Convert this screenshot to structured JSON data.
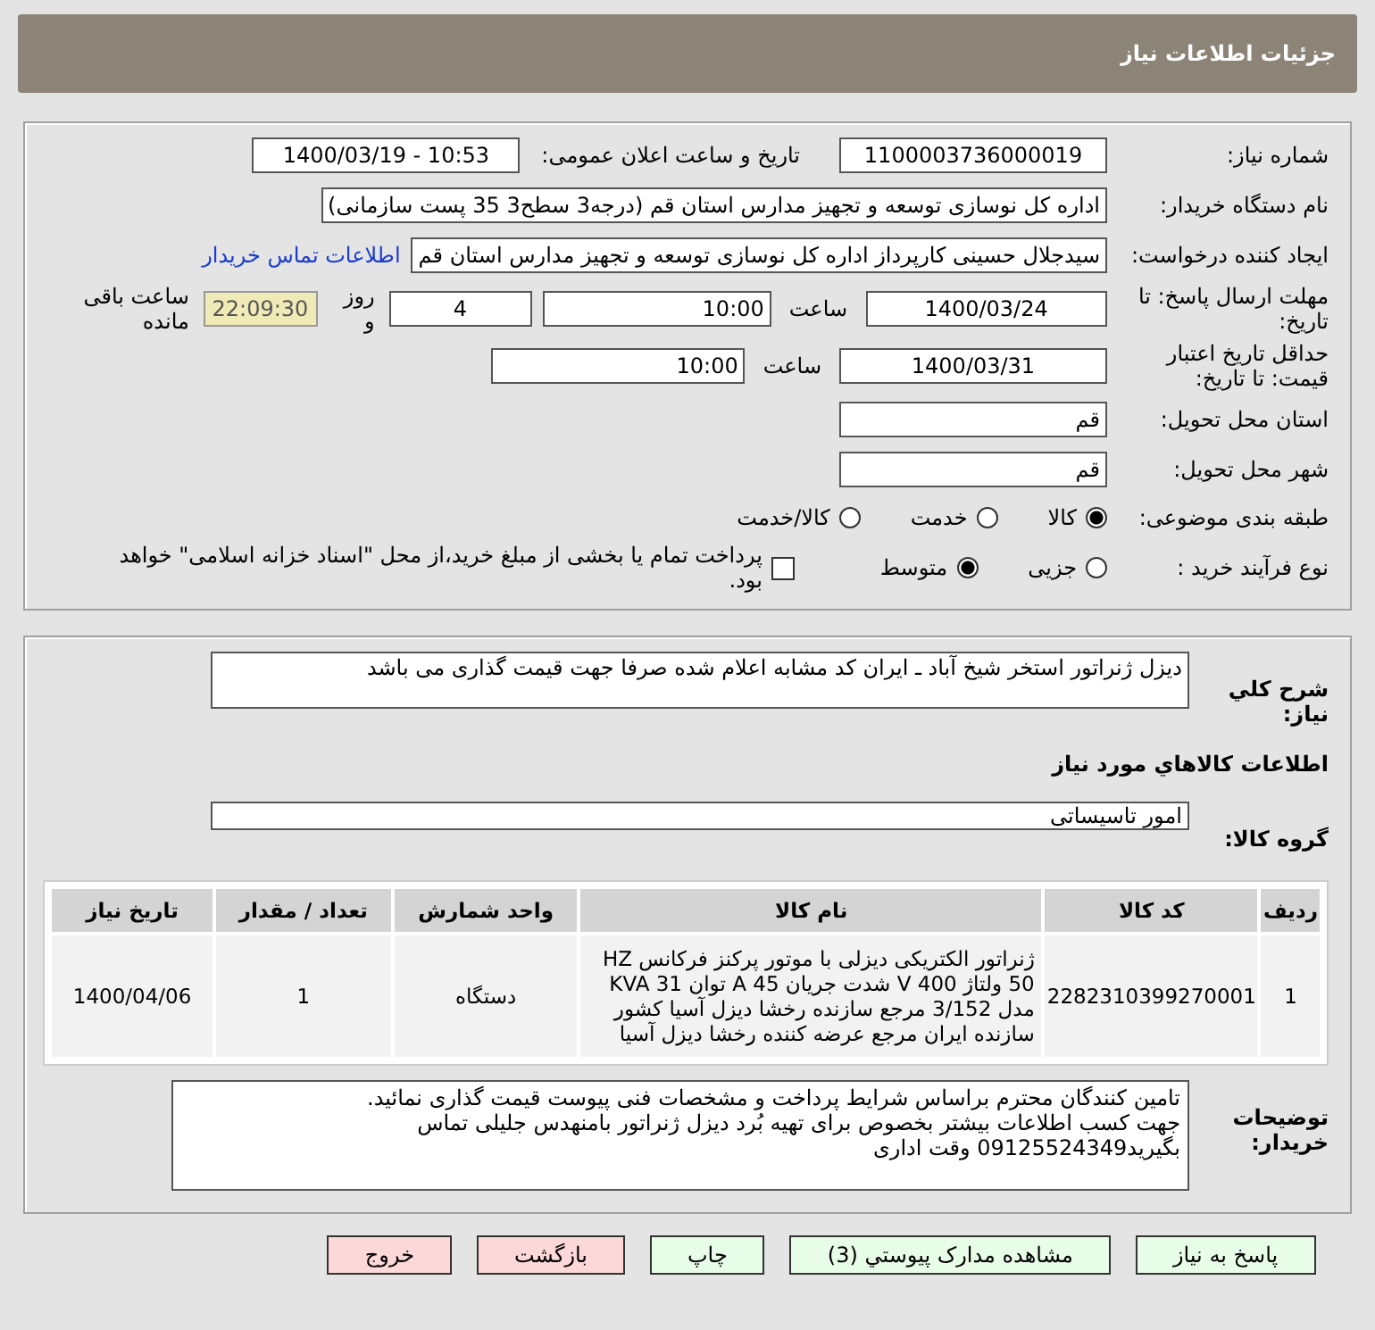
{
  "header": {
    "title": "جزئیات اطلاعات نیاز"
  },
  "details": {
    "need_number": {
      "label": "شماره نیاز:",
      "value": "1100003736000019"
    },
    "announce": {
      "label": "تاریخ و ساعت اعلان عمومی:",
      "value": "1400/03/19 - 10:53"
    },
    "buyer": {
      "label": "نام دستگاه خریدار:",
      "value": "اداره کل نوسازی   توسعه و تجهیز مدارس استان قم (درجه3 سطح3  35 پست سازمانی)"
    },
    "creator": {
      "label": "ایجاد کننده درخواست:",
      "value": "سیدجلال حسینی کارپرداز اداره کل نوسازی   توسعه و تجهیز مدارس استان قم",
      "link": "اطلاعات تماس خریدار"
    },
    "deadline": {
      "label": "مهلت ارسال پاسخ: تا تاریخ:",
      "date": "1400/03/24",
      "time_label": "ساعت",
      "time": "10:00",
      "days": "4",
      "days_label": "روز و",
      "remaining": "22:09:30",
      "remaining_label": "ساعت باقی مانده"
    },
    "validity": {
      "label": "حداقل تاریخ اعتبار قیمت: تا تاریخ:",
      "date": "1400/03/31",
      "time_label": "ساعت",
      "time": "10:00"
    },
    "province": {
      "label": "استان محل تحویل:",
      "value": "قم"
    },
    "city": {
      "label": "شهر محل تحویل:",
      "value": "قم"
    },
    "category": {
      "label": "طبقه بندی موضوعی:",
      "options": [
        {
          "label": "کالا",
          "selected": true
        },
        {
          "label": "خدمت",
          "selected": false
        },
        {
          "label": "کالا/خدمت",
          "selected": false
        }
      ]
    },
    "process": {
      "label": "نوع فرآیند خرید :",
      "options": [
        {
          "label": "جزیی",
          "selected": false
        },
        {
          "label": "متوسط",
          "selected": true
        }
      ],
      "payment": {
        "checked": false,
        "label": "پرداخت تمام یا بخشی از مبلغ خرید،از محل \"اسناد خزانه اسلامی\" خواهد بود."
      }
    }
  },
  "needs": {
    "description": {
      "label": "شرح کلي نياز:",
      "value": "دیزل ژنراتور استخر شیخ آباد ـ ایران کد مشابه اعلام شده صرفا جهت قیمت گذاری می باشد"
    },
    "section_title": "اطلاعات کالاهاي مورد نياز",
    "group": {
      "label": "گروه کالا:",
      "value": "امور تاسیساتی"
    },
    "table": {
      "columns": [
        "ردیف",
        "کد کالا",
        "نام کالا",
        "واحد شمارش",
        "تعداد / مقدار",
        "تاریخ نیاز"
      ],
      "rows": [
        [
          "1",
          "2282310399270001",
          "ژنراتور الکتریکی دیزلی با موتور پرکنز فرکانس HZ 50 ولتاژ 400 V شدت جریان A 45 توان KVA 31 مدل 3/152 مرجع سازنده رخشا دیزل آسیا کشور سازنده ایران مرجع عرضه کننده رخشا دیزل آسیا",
          "دستگاه",
          "1",
          "1400/04/06"
        ]
      ]
    },
    "notes": {
      "label": "توضیحات خریدار:",
      "lines": [
        "تامین کنندگان محترم براساس شرایط پرداخت و مشخصات فنی پیوست قیمت گذاری نمائید.",
        "جهت کسب اطلاعات بیشتر بخصوص برای تهیه بُرد دیزل ژنراتور بامنهدس جلیلی تماس",
        "بگیرید09125524349 وقت اداری"
      ]
    }
  },
  "buttons": [
    {
      "label": "پاسخ به نیاز",
      "color": "#e8fde8"
    },
    {
      "label": "مشاهده مدارک پیوستي (3)",
      "color": "#e8fde8"
    },
    {
      "label": "چاپ",
      "color": "#e8fde8"
    },
    {
      "label": "بازگشت",
      "color": "#fdd8d8"
    },
    {
      "label": "خروج",
      "color": "#fdd8d8"
    }
  ]
}
